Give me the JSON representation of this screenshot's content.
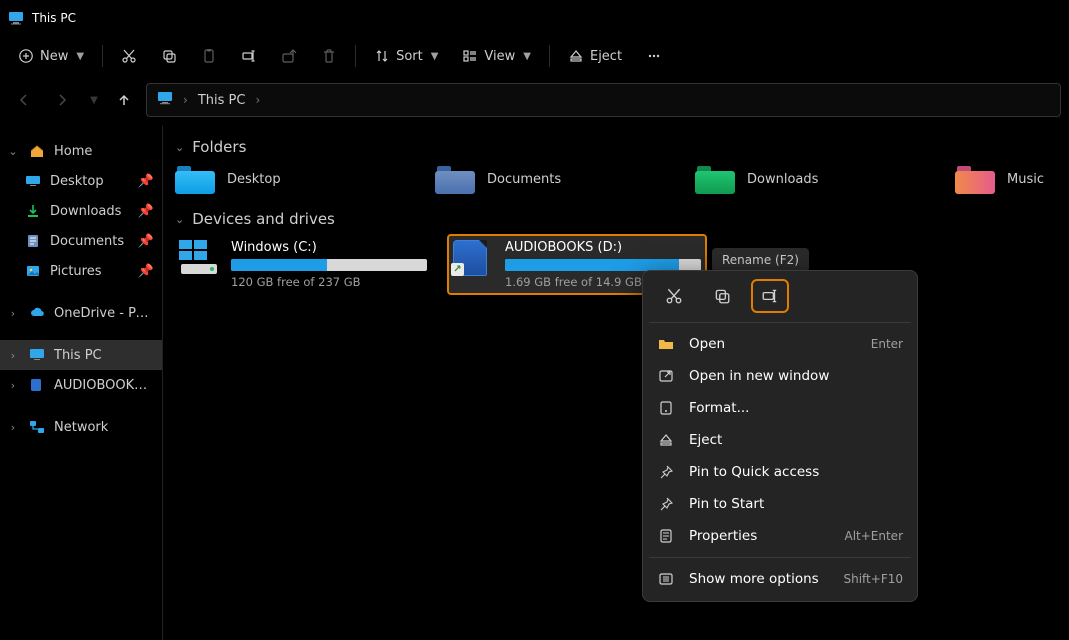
{
  "window": {
    "title": "This PC"
  },
  "toolbar": {
    "new": "New",
    "sort": "Sort",
    "view": "View",
    "eject": "Eject"
  },
  "breadcrumb": {
    "root": "This PC"
  },
  "sidebar": {
    "home": "Home",
    "desktop": "Desktop",
    "downloads": "Downloads",
    "documents": "Documents",
    "pictures": "Pictures",
    "onedrive": "OneDrive - Personal",
    "thispc": "This PC",
    "audiobooks": "AUDIOBOOKS (D:)",
    "network": "Network"
  },
  "sections": {
    "folders": "Folders",
    "drives": "Devices and drives"
  },
  "folders": {
    "desktop": "Desktop",
    "documents": "Documents",
    "downloads": "Downloads",
    "music": "Music"
  },
  "drives": {
    "c": {
      "name": "Windows (C:)",
      "free": "120 GB free of 237 GB",
      "fill_pct": 49
    },
    "d": {
      "name": "AUDIOBOOKS (D:)",
      "free": "1.69 GB free of 14.9 GB",
      "fill_pct": 89
    }
  },
  "tooltip": {
    "rename": "Rename (F2)"
  },
  "ctx": {
    "open": "Open",
    "open_hint": "Enter",
    "open_new": "Open in new window",
    "format": "Format...",
    "eject": "Eject",
    "pin_quick": "Pin to Quick access",
    "pin_start": "Pin to Start",
    "properties": "Properties",
    "properties_hint": "Alt+Enter",
    "more": "Show more options",
    "more_hint": "Shift+F10"
  }
}
